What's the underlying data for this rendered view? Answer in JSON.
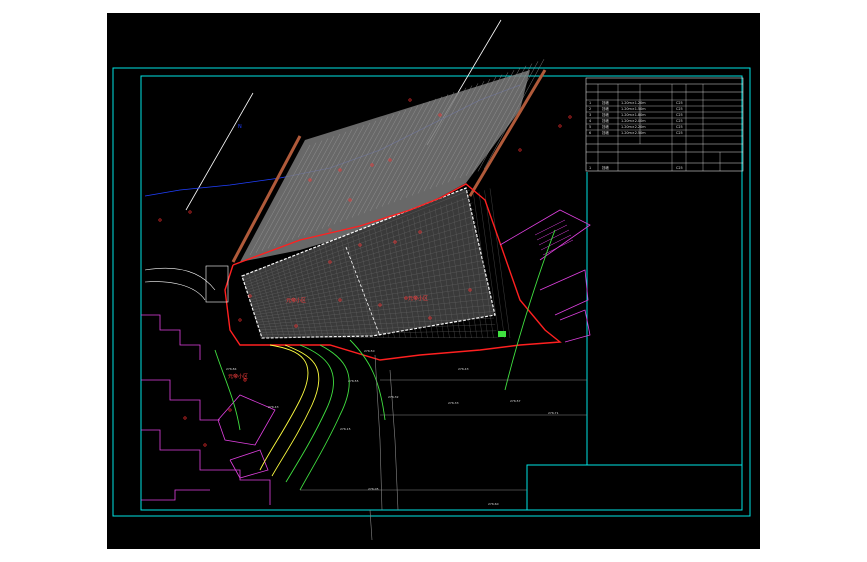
{
  "theme": {
    "background": "#000000",
    "frame_color": "#00e5e5",
    "boundary_red": "#ff2020",
    "lot_white": "#ffffff",
    "slope_gray": "#808080",
    "road_brown": "#b05a3a",
    "building_magenta": "#e040e0",
    "contour_yellow": "#ffff40",
    "contour_green": "#40e040",
    "water_blue": "#2040ff"
  },
  "plan": {
    "area_labels": [
      {
        "text": "元帝小区",
        "color": "#ff4040"
      },
      {
        "text": "元帝小区",
        "color": "#ff4040"
      },
      {
        "text": "元帝小区",
        "color": "#ff4040"
      }
    ],
    "elevations": [
      "276.50",
      "276.43",
      "276.32",
      "276.33",
      "276.57",
      "276.15",
      "276.05",
      "276.60",
      "276.71",
      "276.84",
      "276.43",
      "276.55"
    ],
    "north_marker": "N",
    "legend_table": {
      "rows": [
        [
          "1",
          "挡墙",
          "1.20m×1.20m",
          "C25"
        ],
        [
          "2",
          "挡墙",
          "1.20m×1.50m",
          "C25"
        ],
        [
          "3",
          "挡墙",
          "1.20m×1.80m",
          "C25"
        ],
        [
          "4",
          "挡墙",
          "1.20m×2.00m",
          "C25"
        ],
        [
          "5",
          "挡墙",
          "1.20m×2.20m",
          "C25"
        ],
        [
          "6",
          "挡墙",
          "1.20m×2.50m",
          "C25"
        ]
      ],
      "footer": [
        "1",
        "挡墙",
        "C25"
      ]
    }
  }
}
